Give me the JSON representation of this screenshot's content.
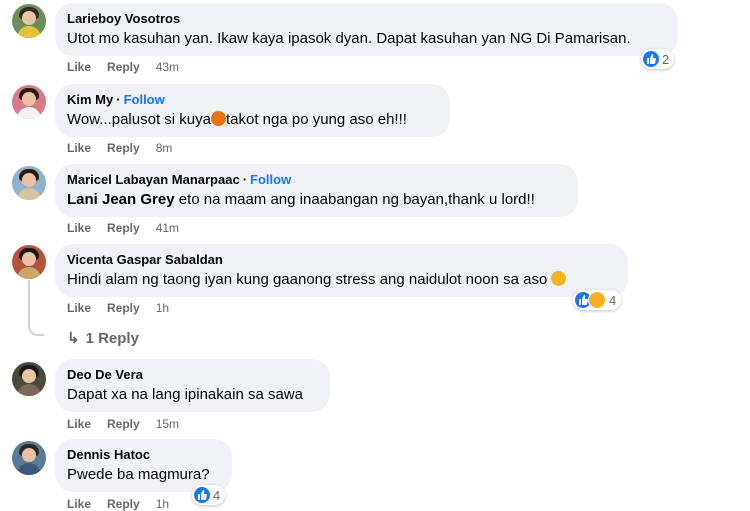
{
  "comments": [
    {
      "author": "Larieboy Vosotros",
      "follow": "",
      "text": "Utot mo kasuhan yan. Ikaw kaya ipasok dyan. Dapat kasuhan yan NG Di Pamarisan.",
      "like": "Like",
      "reply": "Reply",
      "time": "43m",
      "reactions": "2",
      "avatar_color": "#6b8e5a"
    },
    {
      "author": "Kim My",
      "follow": "Follow",
      "text_before": "Wow...palusot si kuya",
      "text_after": "takot nga po yung aso eh!!!",
      "like": "Like",
      "reply": "Reply",
      "time": "8m",
      "avatar_color": "#d97a8a"
    },
    {
      "author": "Maricel Labayan Manarpaac",
      "follow": "Follow",
      "mention": "Lani Jean Grey",
      "text": "eto na maam ang inaabangan ng bayan,thank u lord!!",
      "like": "Like",
      "reply": "Reply",
      "time": "41m",
      "avatar_color": "#8fb3c9"
    },
    {
      "author": "Vicenta Gaspar Sabaldan",
      "follow": "",
      "text": "Hindi alam ng taong iyan kung gaanong stress ang naidulot noon sa aso",
      "like": "Like",
      "reply": "Reply",
      "time": "1h",
      "reactions": "4",
      "avatar_color": "#b5523b"
    },
    {
      "author": "Deo De Vera",
      "follow": "",
      "text": "Dapat xa na lang ipinakain sa sawa",
      "like": "Like",
      "reply": "Reply",
      "time": "15m",
      "avatar_color": "#4a4a3a"
    },
    {
      "author": "Dennis Hatoc",
      "follow": "",
      "text": "Pwede ba magmura?",
      "like": "Like",
      "reply": "Reply",
      "time": "1h",
      "reactions": "4",
      "avatar_color": "#5a7a9a"
    }
  ],
  "reply_thread": {
    "label": "1 Reply",
    "arrow": "↳"
  },
  "separator": "·",
  "colors": {
    "accent": "#1877f2",
    "bubble": "#f0f2f5",
    "muted": "#65676b"
  }
}
